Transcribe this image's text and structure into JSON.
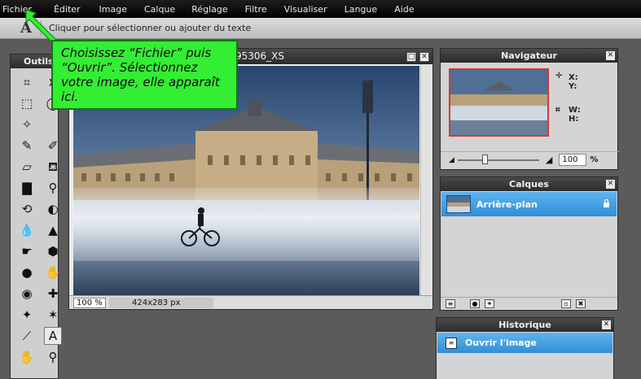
{
  "menu": [
    "Fichier",
    "Éditer",
    "Image",
    "Calque",
    "Réglage",
    "Filtre",
    "Visualiser",
    "Langue",
    "Aide"
  ],
  "options_bar": {
    "tool_glyph": "A",
    "hint": "Cliquer pour sélectionner ou ajouter du texte"
  },
  "tools": {
    "title": "Outils",
    "items": [
      {
        "icon": "crop-icon",
        "glyph": "⌗"
      },
      {
        "icon": "move-icon",
        "glyph": "➤"
      },
      {
        "icon": "marquee-icon",
        "glyph": "⬚"
      },
      {
        "icon": "lasso-icon",
        "glyph": "◯"
      },
      {
        "icon": "magic-wand-icon",
        "glyph": "✧"
      },
      {
        "icon": "blank-icon",
        "glyph": ""
      },
      {
        "icon": "pencil-icon",
        "glyph": "✎"
      },
      {
        "icon": "brush-icon",
        "glyph": "✐"
      },
      {
        "icon": "eraser-icon",
        "glyph": "▱"
      },
      {
        "icon": "paint-bucket-icon",
        "glyph": "⛾"
      },
      {
        "icon": "gradient-icon",
        "glyph": "▇"
      },
      {
        "icon": "clone-stamp-icon",
        "glyph": "⚲"
      },
      {
        "icon": "color-replace-icon",
        "glyph": "⟲"
      },
      {
        "icon": "drawing-icon",
        "glyph": "◐"
      },
      {
        "icon": "blur-icon",
        "glyph": "💧"
      },
      {
        "icon": "sharpen-icon",
        "glyph": "▲"
      },
      {
        "icon": "smudge-icon",
        "glyph": "☛"
      },
      {
        "icon": "sponge-icon",
        "glyph": "⬢"
      },
      {
        "icon": "dodge-icon",
        "glyph": "●"
      },
      {
        "icon": "burn-icon",
        "glyph": "✋"
      },
      {
        "icon": "red-eye-icon",
        "glyph": "◉"
      },
      {
        "icon": "spot-heal-icon",
        "glyph": "✚"
      },
      {
        "icon": "bloat-icon",
        "glyph": "✦"
      },
      {
        "icon": "pinch-icon",
        "glyph": "✶"
      },
      {
        "icon": "color-picker-icon",
        "glyph": "⟋"
      },
      {
        "icon": "text-tool-icon",
        "glyph": "A"
      },
      {
        "icon": "hand-icon",
        "glyph": "✋"
      },
      {
        "icon": "zoom-icon",
        "glyph": "⚲"
      }
    ]
  },
  "document": {
    "title": "95306_XS",
    "zoom": "100 %",
    "dimensions": "424x283 px"
  },
  "callout": {
    "text": "Choisissez “Fichier” puis “Ouvrir”. Sélectionnez votre image, elle apparaît ici.",
    "background": "#33ee33"
  },
  "navigator": {
    "title": "Navigateur",
    "x_label": "X:",
    "y_label": "Y:",
    "w_label": "W:",
    "h_label": "H:",
    "zoom_value": "100",
    "zoom_unit": "%",
    "zoom_slider_level": 0.33
  },
  "layers": {
    "title": "Calques",
    "items": [
      {
        "name": "Arrière-plan",
        "locked": true
      }
    ]
  },
  "history": {
    "title": "Historique",
    "items": [
      {
        "label": "Ouvrir l'image"
      }
    ]
  },
  "colors": {
    "selection_blue": "#3a9be2",
    "nav_frame": "#d23a3a"
  }
}
